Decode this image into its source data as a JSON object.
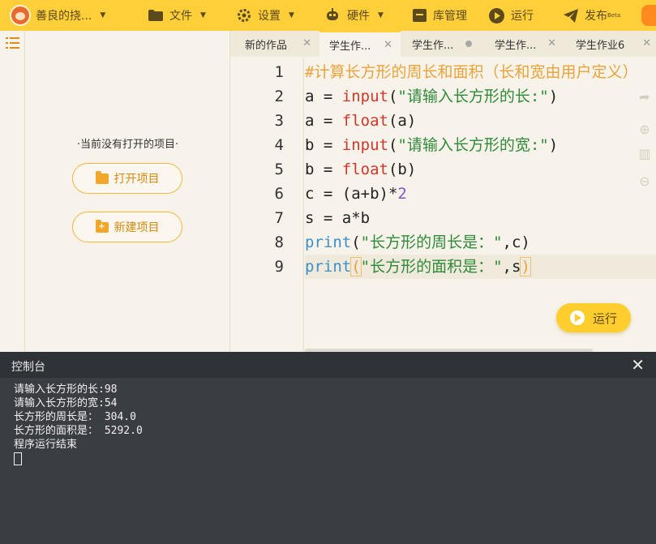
{
  "toolbar": {
    "user": {
      "name": "善良的挠...",
      "icon": "user-avatar-icon"
    },
    "file": {
      "label": "文件",
      "icon": "folder-icon"
    },
    "settings": {
      "label": "设置",
      "icon": "gear-icon"
    },
    "hardware": {
      "label": "硬件",
      "icon": "robot-icon"
    },
    "library": {
      "label": "库管理",
      "icon": "library-box-icon"
    },
    "run": {
      "label": "运行",
      "icon": "play-circle-icon"
    },
    "publish": {
      "label": "发布",
      "badge": "Beta",
      "icon": "paper-plane-icon"
    },
    "accent_color": "#ffcf3a"
  },
  "project_panel": {
    "empty_text": "·当前没有打开的项目·",
    "open_button": "打开项目",
    "new_button": "新建项目"
  },
  "tabs": [
    {
      "label": "新的作品",
      "active": false,
      "state": "close"
    },
    {
      "label": "学生作...",
      "active": true,
      "state": "close"
    },
    {
      "label": "学生作...",
      "active": false,
      "state": "modified"
    },
    {
      "label": "学生作...",
      "active": false,
      "state": "close"
    },
    {
      "label": "学生作业6",
      "active": false,
      "state": "close"
    }
  ],
  "editor": {
    "line_numbers": [
      "1",
      "2",
      "3",
      "4",
      "5",
      "6",
      "7",
      "8",
      "9"
    ],
    "lines": [
      [
        {
          "t": "#计算长方形的周长和面积（长和宽由用户定义）",
          "c": "cm"
        }
      ],
      [
        {
          "t": "a = ",
          "c": ""
        },
        {
          "t": "input",
          "c": "fn"
        },
        {
          "t": "(",
          "c": ""
        },
        {
          "t": "\"请输入长方形的长:\"",
          "c": "st"
        },
        {
          "t": ")",
          "c": ""
        }
      ],
      [
        {
          "t": "a = ",
          "c": ""
        },
        {
          "t": "float",
          "c": "fn"
        },
        {
          "t": "(a)",
          "c": ""
        }
      ],
      [
        {
          "t": "b = ",
          "c": ""
        },
        {
          "t": "input",
          "c": "fn"
        },
        {
          "t": "(",
          "c": ""
        },
        {
          "t": "\"请输入长方形的宽:\"",
          "c": "st"
        },
        {
          "t": ")",
          "c": ""
        }
      ],
      [
        {
          "t": "b = ",
          "c": ""
        },
        {
          "t": "float",
          "c": "fn"
        },
        {
          "t": "(b)",
          "c": ""
        }
      ],
      [
        {
          "t": "c = (a+b)*",
          "c": ""
        },
        {
          "t": "2",
          "c": "nm"
        }
      ],
      [
        {
          "t": "s = a*b",
          "c": ""
        }
      ],
      [
        {
          "t": "print",
          "c": "pr"
        },
        {
          "t": "(",
          "c": ""
        },
        {
          "t": "\"长方形的周长是：\"",
          "c": "st"
        },
        {
          "t": ",c)",
          "c": ""
        }
      ],
      [
        {
          "t": "print",
          "c": "pr"
        },
        {
          "t": "(",
          "c": "br"
        },
        {
          "t": "\"长方形的面积是：\"",
          "c": "st"
        },
        {
          "t": ",s",
          "c": ""
        },
        {
          "t": ")",
          "c": "br"
        }
      ]
    ],
    "run_button": "运行"
  },
  "console": {
    "title": "控制台",
    "close": "✕",
    "output": [
      "请输入长方形的长:98",
      "请输入长方形的宽:54",
      "长方形的周长是： 304.0",
      "长方形的面积是： 5292.0",
      "程序运行结束"
    ]
  }
}
